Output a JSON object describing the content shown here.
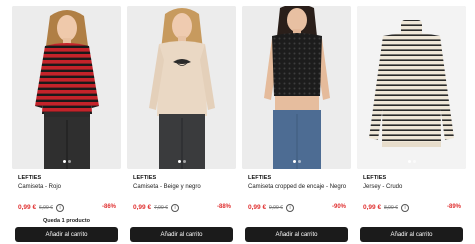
{
  "products": [
    {
      "brand": "LEFTIES",
      "name": "Camiseta - Rojo",
      "price": "0,99 €",
      "old_price": "6,99 €",
      "discount": "-86%",
      "stock_note": "Queda 1 producto",
      "button_label": "Añadir al carrito",
      "info_icon": "ⓘ"
    },
    {
      "brand": "LEFTIES",
      "name": "Camiseta - Beige y negro",
      "price": "0,99 €",
      "old_price": "7,99 €",
      "discount": "-88%",
      "stock_note": "",
      "button_label": "Añadir al carrito",
      "info_icon": "ⓘ"
    },
    {
      "brand": "LEFTIES",
      "name": "Camiseta cropped de encaje - Negro",
      "price": "0,99 €",
      "old_price": "9,99 €",
      "discount": "-90%",
      "stock_note": "",
      "button_label": "Añadir al carrito",
      "info_icon": "ⓘ"
    },
    {
      "brand": "LEFTIES",
      "name": "Jersey - Crudo",
      "price": "0,99 €",
      "old_price": "8,99 €",
      "discount": "-89%",
      "stock_note": "",
      "button_label": "Añadir al carrito",
      "info_icon": "ⓘ"
    }
  ],
  "colors": {
    "sale_red": "#e03131",
    "button_bg": "#1b1b1b",
    "photo_bg": "#ececec"
  }
}
